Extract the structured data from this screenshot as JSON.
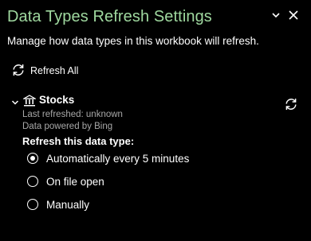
{
  "pane": {
    "title": "Data Types Refresh Settings",
    "subtitle": "Manage how data types in this workbook will refresh."
  },
  "refresh_all": {
    "label": "Refresh All"
  },
  "datatype": {
    "name": "Stocks",
    "last_refreshed": "Last refreshed: unknown",
    "powered_by": "Data powered by Bing",
    "options_title": "Refresh this data type:",
    "options": [
      {
        "label": "Automatically every 5 minutes",
        "selected": true
      },
      {
        "label": "On file open",
        "selected": false
      },
      {
        "label": "Manually",
        "selected": false
      }
    ]
  },
  "colors": {
    "title": "#9fd89f",
    "background": "#000000",
    "muted": "#a8a8a8"
  }
}
